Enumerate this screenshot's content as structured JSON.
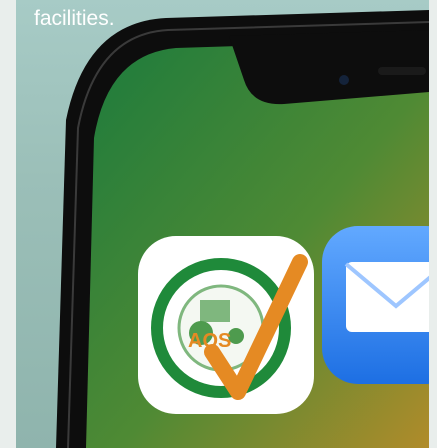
{
  "caption": {
    "text": "facilities."
  },
  "app_icons": [
    {
      "name": "quality-standard-app-icon",
      "label": "AQS",
      "colors": {
        "ring": "#1f8a3a",
        "check": "#e58a23",
        "bg": "#ffffff"
      }
    },
    {
      "name": "mail-app-icon",
      "colors": {
        "top": "#5aa3ff",
        "bottom": "#1e73e8"
      }
    }
  ],
  "colors": {
    "panel": "#a7cbc6",
    "phone_frame": "#111111",
    "screen_top": "#1b7a3e",
    "screen_bottom": "#a58a2a"
  }
}
